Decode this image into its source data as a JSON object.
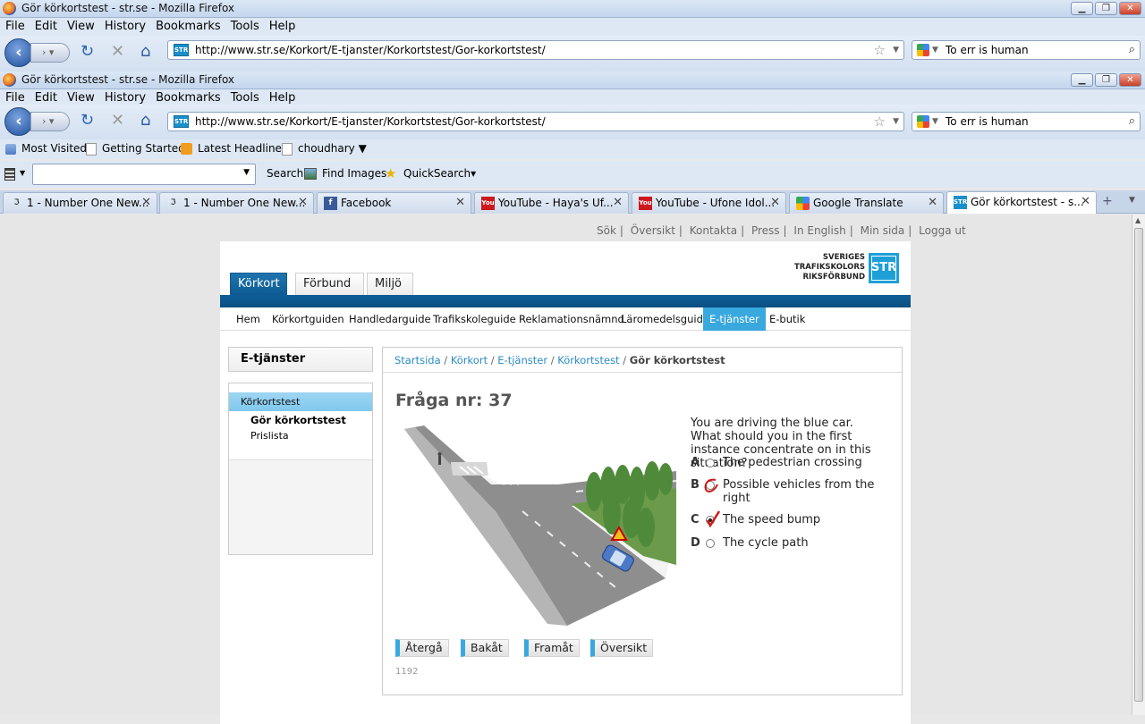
{
  "window": {
    "title": "Gör körkortstest - str.se - Mozilla Firefox"
  },
  "menu": [
    "File",
    "Edit",
    "View",
    "History",
    "Bookmarks",
    "Tools",
    "Help"
  ],
  "nav": {
    "url": "http://www.str.se/Korkort/E-tjanster/Korkortstest/Gor-korkortstest/",
    "search": "To err is human",
    "site_icon": "STR"
  },
  "bookmarks": [
    "Most Visited",
    "Getting Started",
    "Latest Headlines",
    "choudhary ▼"
  ],
  "toolbar2": {
    "search_label": "Search",
    "find_images": "Find Images",
    "quicksearch": "QuickSearch▾"
  },
  "tabs": [
    {
      "label": "1 - Number One New..."
    },
    {
      "label": "1 - Number One New..."
    },
    {
      "label": "Facebook"
    },
    {
      "label": "YouTube - Haya's Uf..."
    },
    {
      "label": "YouTube - Ufone Idol..."
    },
    {
      "label": "Google Translate"
    },
    {
      "label": "Gör körkortstest - s..."
    }
  ],
  "site": {
    "toplinks": [
      "Sök",
      "Översikt",
      "Kontakta",
      "Press",
      "In English",
      "Min sida",
      "Logga ut"
    ],
    "logo": {
      "line1": "SVERIGES",
      "line2": "TRAFIKSKOLORS",
      "line3": "RIKSFÖRBUND",
      "box": "STR"
    },
    "maintabs": [
      "Körkort",
      "Förbund",
      "Miljö"
    ],
    "subnav": [
      "Hem",
      "Körkortguiden",
      "Handledarguide",
      "Trafikskoleguide",
      "Reklamationsnämnd",
      "Läromedelsguide",
      "E-tjänster",
      "E-butik"
    ],
    "sidebar": {
      "title": "E-tjänster",
      "items": [
        "Körkortstest",
        "Gör körkortstest",
        "Prislista"
      ]
    },
    "breadcrumb": [
      "Startsida",
      "Körkort",
      "E-tjänster",
      "Körkortstest",
      "Gör körkortstest"
    ],
    "question": {
      "title": "Fråga nr: 37",
      "text": "You are driving the blue car. What should you in the first instance concentrate on in this situation?",
      "options": [
        {
          "letter": "A",
          "label": "The pedestrian crossing"
        },
        {
          "letter": "B",
          "label": "Possible vehicles from the right"
        },
        {
          "letter": "C",
          "label": "The speed bump"
        },
        {
          "letter": "D",
          "label": "The cycle path"
        }
      ],
      "buttons": [
        "Återgå",
        "Bakåt",
        "Framåt",
        "Översikt"
      ],
      "id": "1192"
    }
  }
}
